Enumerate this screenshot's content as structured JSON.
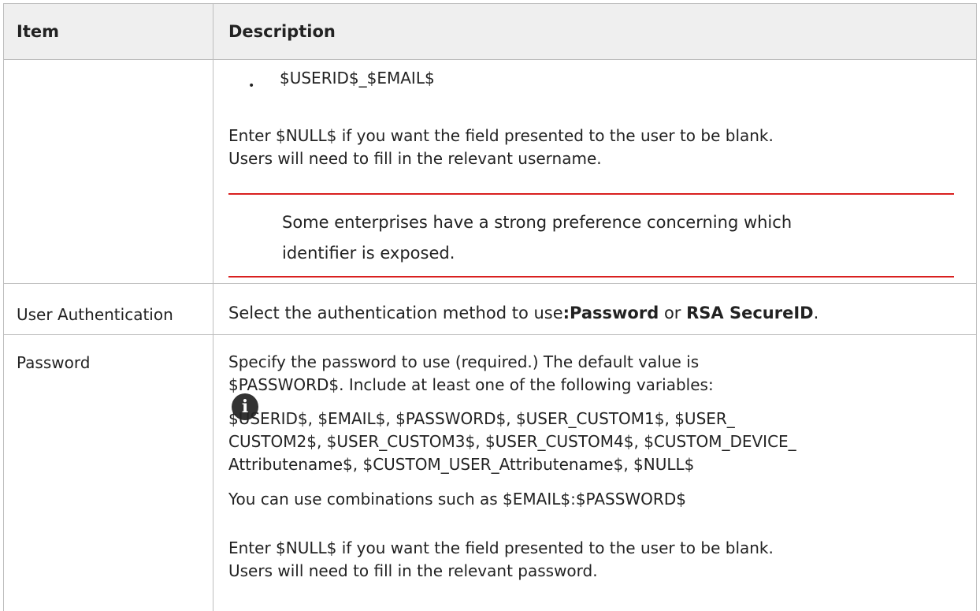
{
  "table": {
    "headers": {
      "item": "Item",
      "description": "Description"
    },
    "row1": {
      "bullet_text": "$USERID$_$EMAIL$",
      "para_lines": [
        "Enter $NULL$ if you want the field presented to the user to be blank.",
        "Users will need to fill in the relevant username."
      ],
      "note_lines": [
        "Some enterprises have a strong preference concerning which",
        "identifier is exposed."
      ],
      "note_icon": "info-icon"
    },
    "row2": {
      "item": "User Authentication",
      "desc_prefix": "Select the authentication method to use",
      "opt1": ":Password",
      "desc_or": " or ",
      "opt2": "RSA SecureID",
      "desc_suffix": "."
    },
    "row3": {
      "item": "Password",
      "p1_lines": [
        "Specify the password to use (required.) The default value is",
        "$PASSWORD$. Include at least one of the following variables:"
      ],
      "p2_lines": [
        "$USERID$, $EMAIL$, $PASSWORD$, $USER_CUSTOM1$, $USER_",
        "CUSTOM2$, $USER_CUSTOM3$, $USER_CUSTOM4$, $CUSTOM_DEVICE_",
        "Attributename$, $CUSTOM_USER_Attributename$, $NULL$"
      ],
      "p3": "You can use combinations such as $EMAIL$:$PASSWORD$",
      "p4_lines": [
        "Enter $NULL$ if you want the field presented to the user to be blank.",
        "Users will need to fill in the relevant password."
      ]
    }
  },
  "colors": {
    "header_bg": "#efefef",
    "border": "#bdbdbd",
    "note_rule": "#d9201f"
  }
}
